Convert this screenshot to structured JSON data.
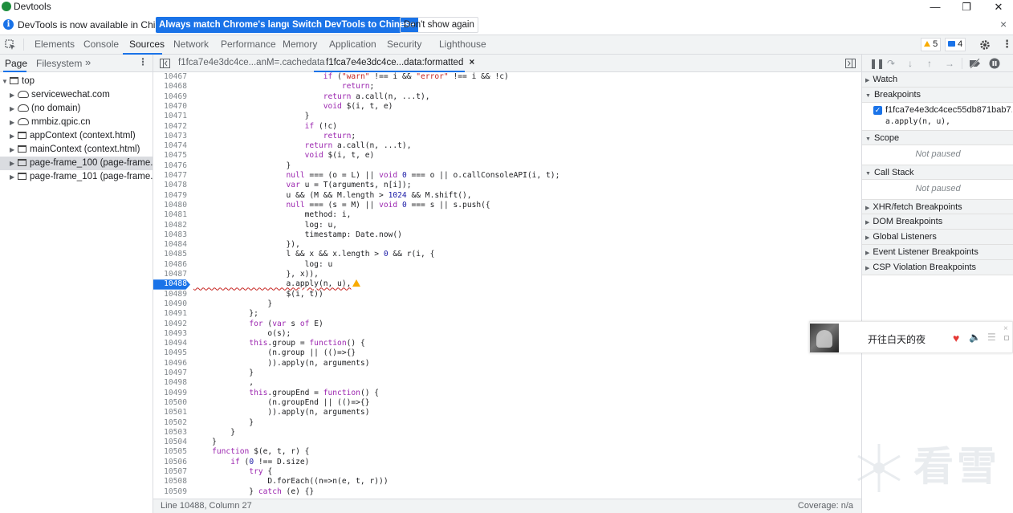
{
  "window": {
    "title": "Devtools",
    "minimize": "—",
    "restore": "❐",
    "close": "✕"
  },
  "infobar": {
    "message": "DevTools is now available in Chinese!",
    "btn_match": "Always match Chrome's language",
    "btn_switch": "Switch DevTools to Chinese",
    "btn_dismiss": "Don't show again",
    "close": "×"
  },
  "main_tabs": [
    "Elements",
    "Console",
    "Sources",
    "Network",
    "Performance",
    "Memory",
    "Application",
    "Security",
    "Lighthouse"
  ],
  "active_tab": "Sources",
  "badges": {
    "warnings": "5",
    "messages": "4"
  },
  "navigator": {
    "tabs": [
      "Page",
      "Filesystem"
    ],
    "more": "»",
    "items": [
      {
        "label": "top",
        "indent": 0,
        "icon": "frame"
      },
      {
        "label": "servicewechat.com",
        "indent": 1,
        "icon": "cloud"
      },
      {
        "label": "(no domain)",
        "indent": 1,
        "icon": "cloud"
      },
      {
        "label": "mmbiz.qpic.cn",
        "indent": 1,
        "icon": "cloud"
      },
      {
        "label": "appContext (context.html)",
        "indent": 1,
        "icon": "frame"
      },
      {
        "label": "mainContext (context.html)",
        "indent": 1,
        "icon": "frame"
      },
      {
        "label": "page-frame_100 (page-frame.htm",
        "indent": 1,
        "icon": "frame"
      },
      {
        "label": "page-frame_101 (page-frame.htm",
        "indent": 1,
        "icon": "frame"
      }
    ]
  },
  "editor": {
    "tabs": [
      "f1fca7e4e3dc4ce...anM=.cachedata",
      "f1fca7e4e3dc4ce...data:formatted"
    ],
    "tab_close": "×",
    "status_left": "Line 10488, Column 27",
    "status_right": "Coverage: n/a",
    "breakpoint_line": "10488",
    "lines": [
      [
        "10467",
        "                            if (\"warn\" !== i && \"error\" !== i && !c)"
      ],
      [
        "10468",
        "                                return;"
      ],
      [
        "10469",
        "                            return a.call(n, ...t),"
      ],
      [
        "10470",
        "                            void $(i, t, e)"
      ],
      [
        "10471",
        "                        }"
      ],
      [
        "10472",
        "                        if (!c)"
      ],
      [
        "10473",
        "                            return;"
      ],
      [
        "10474",
        "                        return a.call(n, ...t),"
      ],
      [
        "10475",
        "                        void $(i, t, e)"
      ],
      [
        "10476",
        "                    }"
      ],
      [
        "10477",
        "                    null === (o = L) || void 0 === o || o.callConsoleAPI(i, t);"
      ],
      [
        "10478",
        "                    var u = T(arguments, n[i]);"
      ],
      [
        "10479",
        "                    u && (M && M.length > 1024 && M.shift(),"
      ],
      [
        "10480",
        "                    null === (s = M) || void 0 === s || s.push({"
      ],
      [
        "10481",
        "                        method: i,"
      ],
      [
        "10482",
        "                        log: u,"
      ],
      [
        "10483",
        "                        timestamp: Date.now()"
      ],
      [
        "10484",
        "                    }),"
      ],
      [
        "10485",
        "                    l && x && x.length > 0 && r(i, {"
      ],
      [
        "10486",
        "                        log: u"
      ],
      [
        "10487",
        "                    }, x)),"
      ],
      [
        "10488",
        "                    a.apply(n, u),"
      ],
      [
        "10489",
        "                    $(i, t))"
      ],
      [
        "10490",
        "                }"
      ],
      [
        "10491",
        "            };"
      ],
      [
        "10492",
        "            for (var s of E)"
      ],
      [
        "10493",
        "                o(s);"
      ],
      [
        "10494",
        "            this.group = function() {"
      ],
      [
        "10495",
        "                (n.group || (()=>{}"
      ],
      [
        "10496",
        "                )).apply(n, arguments)"
      ],
      [
        "10497",
        "            }"
      ],
      [
        "10498",
        "            ,"
      ],
      [
        "10499",
        "            this.groupEnd = function() {"
      ],
      [
        "10500",
        "                (n.groupEnd || (()=>{}"
      ],
      [
        "10501",
        "                )).apply(n, arguments)"
      ],
      [
        "10502",
        "            }"
      ],
      [
        "10503",
        "        }"
      ],
      [
        "10504",
        "    }"
      ],
      [
        "10505",
        "    function $(e, t, r) {"
      ],
      [
        "10506",
        "        if (0 !== D.size)"
      ],
      [
        "10507",
        "            try {"
      ],
      [
        "10508",
        "                D.forEach((n=>n(e, t, r)))"
      ],
      [
        "10509",
        "            } catch (e) {}"
      ]
    ]
  },
  "debugger": {
    "sections": {
      "watch": "Watch",
      "breakpoints": "Breakpoints",
      "scope": "Scope",
      "call_stack": "Call Stack",
      "xhr": "XHR/fetch Breakpoints",
      "dom": "DOM Breakpoints",
      "global": "Global Listeners",
      "event": "Event Listener Breakpoints",
      "csp": "CSP Violation Breakpoints"
    },
    "breakpoint_file": "f1fca7e4e3dc4cec55db871bab7...",
    "breakpoint_code": "a.apply(n, u),",
    "not_paused": "Not paused"
  },
  "music": {
    "song": "开往白天的夜"
  },
  "watermark": "看雪"
}
